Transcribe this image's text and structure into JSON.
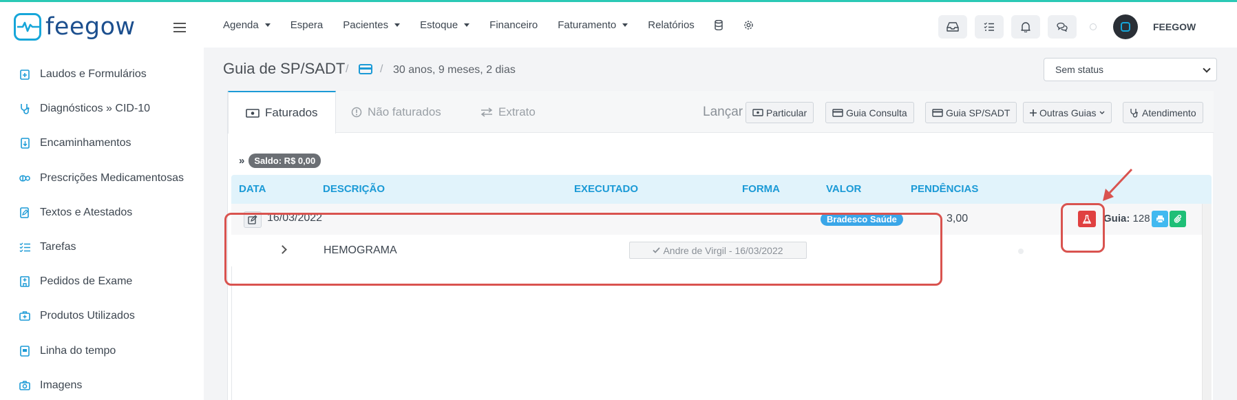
{
  "brand": {
    "name": "feegow",
    "accent": "#1b9ad6",
    "logo_color": "#1c4f8e"
  },
  "sidebar": {
    "items": [
      {
        "label": "Laudos e Formulários",
        "icon": "clipboard-plus-icon"
      },
      {
        "label": "Diagnósticos » CID-10",
        "icon": "stethoscope-icon"
      },
      {
        "label": "Encaminhamentos",
        "icon": "file-arrow-icon"
      },
      {
        "label": "Prescrições Medicamentosas",
        "icon": "pills-icon"
      },
      {
        "label": "Textos e Atestados",
        "icon": "file-edit-icon"
      },
      {
        "label": "Tarefas",
        "icon": "task-list-icon"
      },
      {
        "label": "Pedidos de Exame",
        "icon": "hospital-icon"
      },
      {
        "label": "Produtos Utilizados",
        "icon": "medkit-icon"
      },
      {
        "label": "Linha do tempo",
        "icon": "timeline-icon"
      },
      {
        "label": "Imagens",
        "icon": "camera-icon"
      }
    ]
  },
  "topnav": {
    "items": [
      {
        "label": "Agenda",
        "dropdown": true
      },
      {
        "label": "Espera",
        "dropdown": false
      },
      {
        "label": "Pacientes",
        "dropdown": true
      },
      {
        "label": "Estoque",
        "dropdown": true
      },
      {
        "label": "Financeiro",
        "dropdown": false
      },
      {
        "label": "Faturamento",
        "dropdown": true
      },
      {
        "label": "Relatórios",
        "dropdown": false
      }
    ],
    "icons": [
      "database-icon",
      "gear-icon"
    ],
    "right_icons": [
      "inbox-icon",
      "checklist-icon",
      "bell-icon",
      "chat-icon"
    ],
    "user": "FEEGOW"
  },
  "page": {
    "title": "Guia de SP/SADT",
    "separator": "/",
    "age": "30 anos, 9 meses, 2 dias",
    "status": "Sem status"
  },
  "tabs": [
    {
      "label": "Faturados",
      "icon": "money-icon",
      "active": true
    },
    {
      "label": "Não faturados",
      "icon": "info-circle-icon",
      "active": false
    },
    {
      "label": "Extrato",
      "icon": "exchange-icon",
      "active": false
    }
  ],
  "toolbar": {
    "lancar": "Lançar",
    "buttons": {
      "particular": "Particular",
      "guia_consulta": "Guia Consulta",
      "guia_sadt": "Guia SP/SADT",
      "outras": "Outras Guias",
      "atendimento": "Atendimento"
    }
  },
  "saldo": {
    "arrow": "»",
    "label": "Saldo: R$ 0,00"
  },
  "table": {
    "headers": {
      "data": "DATA",
      "descricao": "DESCRIÇÃO",
      "executado": "EXECUTADO",
      "forma": "FORMA",
      "valor": "VALOR",
      "pendencias": "PENDÊNCIAS"
    },
    "row": {
      "date": "16/03/2022",
      "forma": "Bradesco Saúde",
      "valor": "3,00",
      "guia_label": "Guia:",
      "guia_number": "128",
      "item": {
        "description": "HEMOGRAMA",
        "executed_by": "Andre de Virgil - 16/03/2022"
      }
    }
  },
  "colors": {
    "highlight": "#d9534f",
    "flask_button": "#e04040",
    "badge": "#3aa6e8",
    "print_button": "#41b9f0",
    "clip_button": "#1fbf77"
  }
}
